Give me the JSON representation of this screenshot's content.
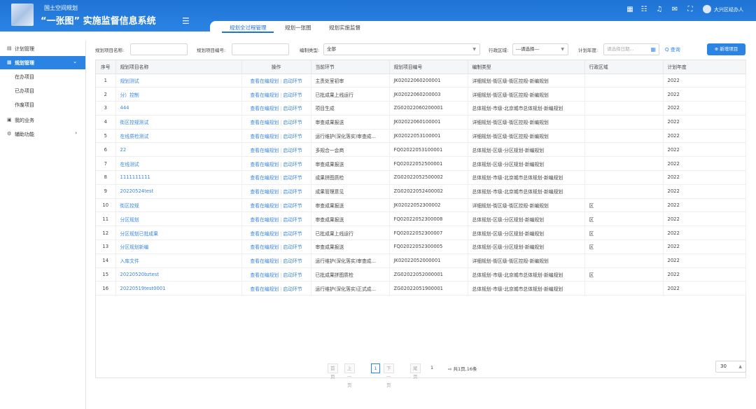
{
  "header": {
    "subtitle": "国土空间规划",
    "title": "“一张图” 实施监督信息系统",
    "tabs": [
      {
        "label": "规划全过程管理",
        "active": true
      },
      {
        "label": "规划一张图",
        "active": false
      },
      {
        "label": "规划实施监督",
        "active": false
      }
    ],
    "icons": [
      "grid-icon",
      "list-icon",
      "bell-icon",
      "mail-icon",
      "fullscreen-icon"
    ],
    "user": "大兴区经办人"
  },
  "sidebar": {
    "items": [
      {
        "label": "计划管理",
        "icon": "▤"
      },
      {
        "label": "规划管理",
        "icon": "▦",
        "active": true,
        "arrow": "⌄"
      },
      {
        "label": "在办项目",
        "sub": true
      },
      {
        "label": "已办项目",
        "sub": true
      },
      {
        "label": "作废项目",
        "sub": true
      },
      {
        "label": "我的业务",
        "icon": "▣"
      },
      {
        "label": "辅助功能",
        "icon": "⚙",
        "arrow": "›"
      }
    ]
  },
  "filters": {
    "name_label": "规划项目名称:",
    "name_value": "",
    "code_label": "规划项目编号:",
    "code_value": "",
    "type_label": "编制类型:",
    "type_value": "全部",
    "region_label": "行政区域:",
    "region_value": "---请选择---",
    "year_label": "计划年度:",
    "year_placeholder": "请选择日期...",
    "query_label": "Q 查询",
    "new_label": "⊕ 新增项目"
  },
  "table": {
    "columns": [
      "序号",
      "规划项目名称",
      "操作",
      "当前环节",
      "规划项目编号",
      "编制类型",
      "行政区域",
      "计划年度"
    ],
    "op_view": "查看在编规划",
    "op_start": "启动环节",
    "rows": [
      {
        "no": "1",
        "name": "规划测试",
        "step": "主责处室初审",
        "code": "JK02022060200001",
        "type": "详细规划-街区级-街区控规-新编规划",
        "region": "",
        "year": "2022"
      },
      {
        "no": "2",
        "name": "分）控制",
        "step": "已批成果上线运行",
        "code": "JK02022060200003",
        "type": "详细规划-街区级-街区控规-新编规划",
        "region": "",
        "year": "2022"
      },
      {
        "no": "3",
        "name": "444",
        "step": "项目生成",
        "code": "ZG02022060200001",
        "type": "总体规划-市级-北京城市总体规划-新编规划",
        "region": "",
        "year": "2022"
      },
      {
        "no": "4",
        "name": "街区控规测试",
        "step": "审查成果报送",
        "code": "JK02022060100001",
        "type": "详细规划-街区级-街区控规-新编规划",
        "region": "",
        "year": "2022"
      },
      {
        "no": "5",
        "name": "在线质检测试",
        "step": "运行维护(深化落实)审查成...",
        "code": "JK02022053100001",
        "type": "详细规划-街区级-街区控规-新编规划",
        "region": "",
        "year": "2022"
      },
      {
        "no": "6",
        "name": "22",
        "step": "多规合一会商",
        "code": "FQ02022053100001",
        "type": "总体规划-区级-分区规划-新编规划",
        "region": "",
        "year": "2022"
      },
      {
        "no": "7",
        "name": "在线测试",
        "step": "审查成果报送",
        "code": "FQ02022052500001",
        "type": "总体规划-区级-分区规划-新编规划",
        "region": "",
        "year": "2022"
      },
      {
        "no": "8",
        "name": "1111111111",
        "step": "成果拼图质检",
        "code": "ZG02022052500002",
        "type": "总体规划-市级-北京城市总体规划-新编规划",
        "region": "",
        "year": "2022"
      },
      {
        "no": "9",
        "name": "20220524test",
        "step": "成果管理意见",
        "code": "ZG02022052400002",
        "type": "总体规划-市级-北京城市总体规划-新编规划",
        "region": "",
        "year": "2022"
      },
      {
        "no": "10",
        "name": "街区控规",
        "step": "审查成果报送",
        "code": "JK02022052300002",
        "type": "详细规划-街区级-街区控规-新编规划",
        "region": "区",
        "year": "2022"
      },
      {
        "no": "11",
        "name": "分区规划",
        "step": "审查成果报送",
        "code": "FQ02022052300008",
        "type": "总体规划-区级-分区规划-新编规划",
        "region": "区",
        "year": "2022"
      },
      {
        "no": "12",
        "name": "分区规划已批成果",
        "step": "已批成果上线运行",
        "code": "FQ02022052300007",
        "type": "总体规划-区级-分区规划-新编规划",
        "region": "区",
        "year": "2022"
      },
      {
        "no": "13",
        "name": "分区规划新编",
        "step": "审查成果报送",
        "code": "FQ02022052300005",
        "type": "总体规划-区级-分区规划-新编规划",
        "region": "区",
        "year": "2022"
      },
      {
        "no": "14",
        "name": "入库文件",
        "step": "运行维护(深化落实)审查成...",
        "code": "JK02022052000001",
        "type": "详细规划-街区级-街区控规-新编规划",
        "region": "",
        "year": "2022"
      },
      {
        "no": "15",
        "name": "20220520bztest",
        "step": "已批成果拼图质检",
        "code": "ZG02022052000001",
        "type": "总体规划-市级-北京城市总体规划-新编规划",
        "region": "区",
        "year": "2022"
      },
      {
        "no": "16",
        "name": "20220519test0001",
        "step": "运行维护(深化落实)正式成...",
        "code": "ZG02022051900001",
        "type": "总体规划-市级-北京城市总体规划-新编规划",
        "region": "",
        "year": "2022"
      }
    ]
  },
  "pager": {
    "first": "首页",
    "prev": "上一页",
    "current": "1",
    "next": "下一页",
    "last": "尾页",
    "page_input": "1",
    "summary": "⇨ 共1页,16条",
    "page_size": "30"
  }
}
